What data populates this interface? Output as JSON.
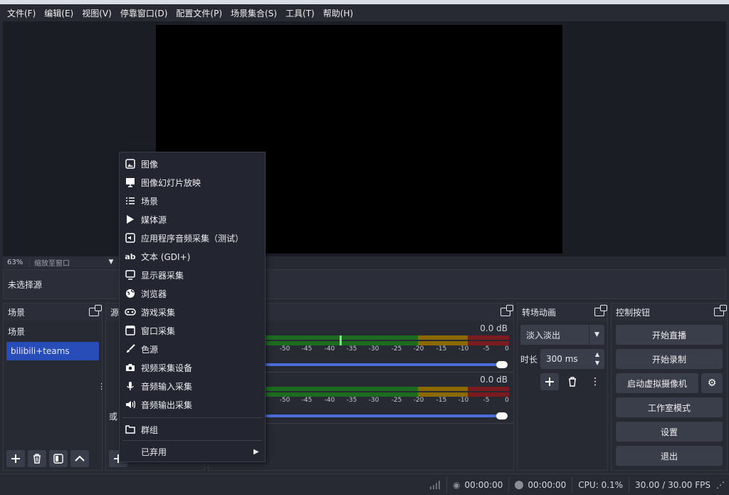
{
  "menu": [
    "文件(F)",
    "编辑(E)",
    "视图(V)",
    "停靠窗口(D)",
    "配置文件(P)",
    "场景集合(S)",
    "工具(T)",
    "帮助(H)"
  ],
  "zoom": {
    "percent": "63%",
    "mode": "缩放至窗口"
  },
  "source_status": "未选择源",
  "scenes": {
    "title": "场景",
    "items": [
      "场景",
      "bilibili+teams"
    ],
    "selected": 1
  },
  "sources": {
    "title_partial": "源"
  },
  "mixer": {
    "rows": [
      {
        "db": "0.0 dB",
        "label_partial": ""
      },
      {
        "db": "0.0 dB",
        "label_partial": "或"
      }
    ],
    "ticks": [
      "-50",
      "-45",
      "-40",
      "-35",
      "-30",
      "-25",
      "-20",
      "-15",
      "-10",
      "-5",
      "0"
    ]
  },
  "transitions": {
    "title": "转场动画",
    "selected": "淡入淡出",
    "duration_label": "时长",
    "duration": "300 ms"
  },
  "controls": {
    "title": "控制按钮",
    "start_stream": "开始直播",
    "start_record": "开始录制",
    "virtual_cam": "启动虚拟摄像机",
    "studio_mode": "工作室模式",
    "settings": "设置",
    "exit": "退出"
  },
  "context_menu": [
    {
      "label": "图像",
      "icon": "image-icon"
    },
    {
      "label": "图像幻灯片放映",
      "icon": "slideshow-icon"
    },
    {
      "label": "场景",
      "icon": "list-icon"
    },
    {
      "label": "媒体源",
      "icon": "play-icon"
    },
    {
      "label": "应用程序音频采集（测试）",
      "icon": "app-audio-icon"
    },
    {
      "label": "文本 (GDI+)",
      "icon": "text-icon"
    },
    {
      "label": "显示器采集",
      "icon": "monitor-icon"
    },
    {
      "label": "浏览器",
      "icon": "globe-icon"
    },
    {
      "label": "游戏采集",
      "icon": "gamepad-icon"
    },
    {
      "label": "窗口采集",
      "icon": "window-icon"
    },
    {
      "label": "色源",
      "icon": "brush-icon"
    },
    {
      "label": "视频采集设备",
      "icon": "camera-icon"
    },
    {
      "label": "音频输入采集",
      "icon": "mic-icon"
    },
    {
      "label": "音频输出采集",
      "icon": "speaker-icon"
    },
    {
      "label": "群组",
      "icon": "folder-icon"
    },
    {
      "label": "已弃用",
      "icon": "chevron-right-icon"
    }
  ],
  "status": {
    "stream_time": "00:00:00",
    "rec_time": "00:00:00",
    "cpu": "CPU: 0.1%",
    "fps": "30.00 / 30.00 FPS"
  }
}
